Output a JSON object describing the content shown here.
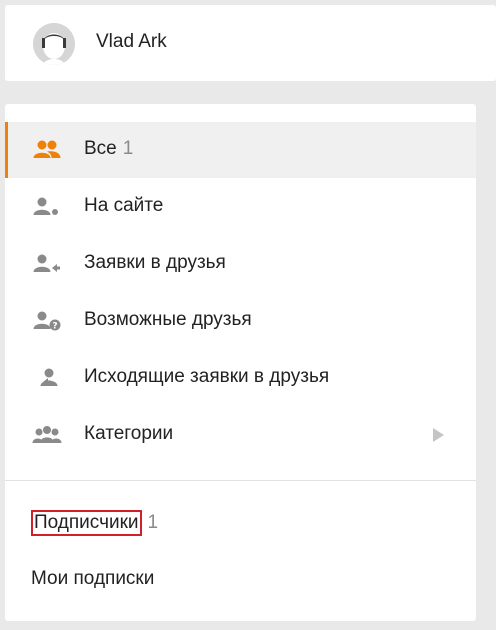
{
  "profile": {
    "name": "Vlad Ark"
  },
  "menu": {
    "items": [
      {
        "label": "Все",
        "count": "1",
        "icon": "friends-icon",
        "active": true
      },
      {
        "label": "На сайте",
        "icon": "user-online-icon"
      },
      {
        "label": "Заявки в друзья",
        "icon": "friend-request-icon"
      },
      {
        "label": "Возможные друзья",
        "icon": "possible-friend-icon"
      },
      {
        "label": "Исходящие заявки в друзья",
        "icon": "outgoing-request-icon"
      },
      {
        "label": "Категории",
        "icon": "categories-icon",
        "has_submenu": true
      }
    ]
  },
  "links": {
    "subscribers_label": "Подписчики",
    "subscribers_count": "1",
    "my_subscriptions_label": "Мои подписки"
  },
  "colors": {
    "accent": "#ee8208",
    "icon_gray": "#8a8a8a",
    "highlight": "#d0202a",
    "background": "#e9e9e9"
  }
}
